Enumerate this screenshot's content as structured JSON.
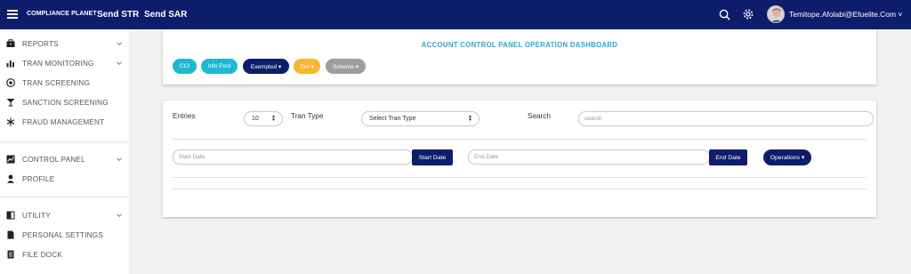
{
  "header": {
    "brand": "COMPLIANCE PLANET",
    "links": [
      "Send STR",
      "Send SAR"
    ],
    "user": "Temitope.Afolabi@Efuelite.Com ˅"
  },
  "sidebar": {
    "items": [
      {
        "label": "REPORTS",
        "icon": "briefcase-icon",
        "chevron": true
      },
      {
        "label": "TRAN MONITORING",
        "icon": "bar-chart-icon",
        "chevron": true
      },
      {
        "label": "TRAN SCREENING",
        "icon": "globe-icon",
        "chevron": false
      },
      {
        "label": "SANCTION SCREENING",
        "icon": "cocktail-icon",
        "chevron": false
      },
      {
        "label": "FRAUD MANAGEMENT",
        "icon": "snowflake-icon",
        "chevron": false
      },
      {
        "label": "CONTROL PANEL",
        "icon": "line-chart-icon",
        "chevron": true
      },
      {
        "label": "PROFILE",
        "icon": "user-icon",
        "chevron": false
      },
      {
        "label": "UTILITY",
        "icon": "book-icon",
        "chevron": true
      },
      {
        "label": "PERSONAL SETTINGS",
        "icon": "file-icon",
        "chevron": false
      },
      {
        "label": "FILE DOCK",
        "icon": "document-icon",
        "chevron": false
      }
    ]
  },
  "dashboard": {
    "title": "ACCOUNT CONTROL PANEL OPERATION DASHBOARD",
    "pills": [
      "CCI",
      "Info Pool",
      "Exempted ▾",
      "Tier ▾",
      "Scheme ▾"
    ],
    "pill_colors": {
      "info": "#1fb8d3",
      "navy": "#0c1e6b",
      "warning": "#f8b730",
      "grey": "#9e9e9e"
    }
  },
  "filters": {
    "entries_label": "Entries",
    "entries_value": "10",
    "tran_type_label": "Tran Type",
    "tran_type_value": "Select Tran Type",
    "search_label": "Search",
    "search_placeholder": "search",
    "start_placeholder": "Start Date",
    "start_button": "Start Date",
    "end_placeholder": "End Date",
    "end_button": "End Date",
    "operations_button": "Operations ▾"
  },
  "colors": {
    "navbar": "#0c1e6b",
    "title_blue": "#2da5d6"
  }
}
